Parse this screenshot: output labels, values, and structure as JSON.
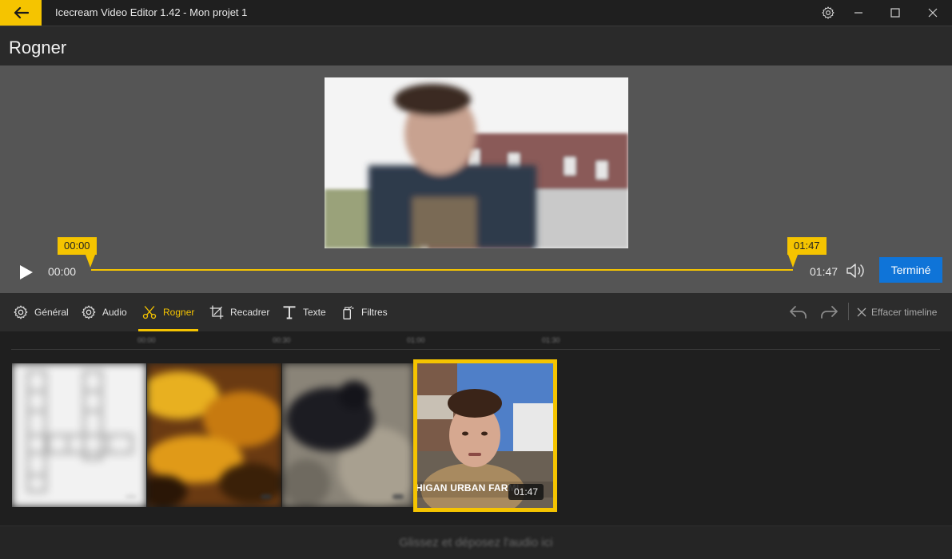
{
  "app": {
    "title": "Icecream Video Editor 1.42 - Mon projet 1"
  },
  "header": {
    "title": "Rogner"
  },
  "player": {
    "current_time": "00:00",
    "end_time": "01:47",
    "start_marker": "00:00",
    "end_marker": "01:47",
    "done_label": "Terminé",
    "trim_start_fraction": 0.0,
    "trim_end_fraction": 1.0
  },
  "toolbar": {
    "tools": [
      {
        "label": "Général",
        "icon": "gear-icon"
      },
      {
        "label": "Audio",
        "icon": "gear-icon"
      },
      {
        "label": "Rogner",
        "icon": "scissors-icon",
        "active": true
      },
      {
        "label": "Recadrer",
        "icon": "crop-icon"
      },
      {
        "label": "Texte",
        "icon": "text-icon"
      },
      {
        "label": "Filtres",
        "icon": "filter-icon"
      }
    ],
    "clear_label": "Effacer timeline"
  },
  "timeline": {
    "ticks": [
      "00:00",
      "00:30",
      "01:00",
      "01:30"
    ],
    "clips": [
      {
        "duration": ""
      },
      {
        "duration": ""
      },
      {
        "duration": ""
      },
      {
        "duration": "01:47",
        "selected": true,
        "caption": "HIGAN URBAN FARMI"
      }
    ]
  },
  "audio_zone": {
    "hint": "Glissez et déposez l'audio ici"
  },
  "colors": {
    "accent": "#f5c400",
    "primary_button": "#0f74d8",
    "preview_bg": "#555555",
    "titlebar_bg": "#1f1f1f"
  }
}
